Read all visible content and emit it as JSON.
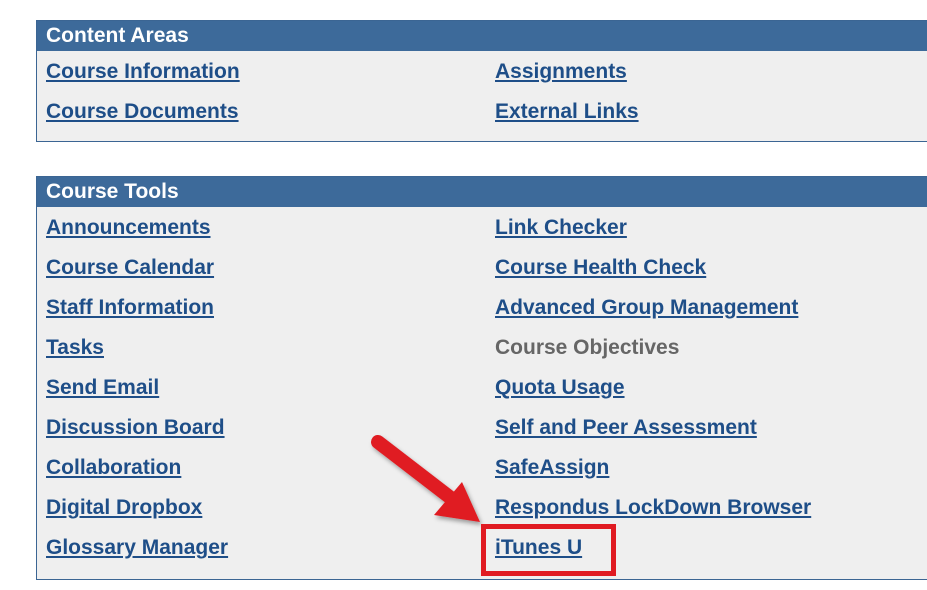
{
  "content_areas": {
    "title": "Content Areas",
    "left": [
      "Course Information",
      "Course Documents"
    ],
    "right": [
      "Assignments",
      "External Links"
    ]
  },
  "course_tools": {
    "title": "Course Tools",
    "left": [
      "Announcements",
      "Course Calendar",
      "Staff Information",
      "Tasks",
      "Send Email",
      "Discussion Board",
      "Collaboration",
      "Digital Dropbox",
      "Glossary Manager"
    ],
    "right": [
      "Link Checker",
      "Course Health Check",
      "Advanced Group Management",
      "Course Objectives",
      "Quota Usage",
      "Self and Peer Assessment",
      "SafeAssign",
      "Respondus LockDown Browser",
      "iTunes U"
    ]
  },
  "annotation": {
    "highlighted_item": "iTunes U",
    "accent_color": "#e01b22",
    "icons": [
      "red-arrow-icon"
    ]
  },
  "colors": {
    "header_bg": "#3d6a9a",
    "link": "#1e4e88",
    "panel_bg": "#efefef",
    "disabled_text": "#666666"
  }
}
